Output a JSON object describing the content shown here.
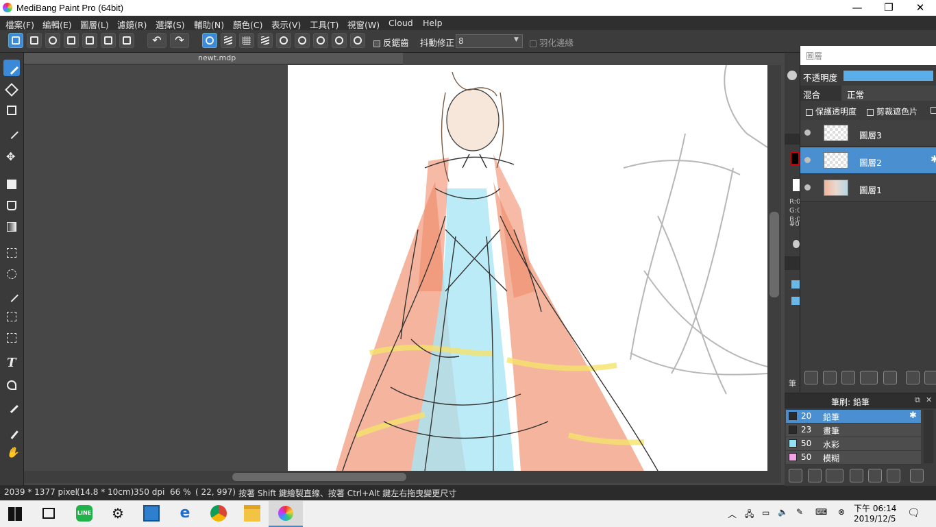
{
  "window": {
    "title": "MediBang Paint Pro (64bit)",
    "minimize": "—",
    "maximize": "❐",
    "close": "✕"
  },
  "menu": [
    "檔案(F)",
    "編輯(E)",
    "圖層(L)",
    "濾鏡(R)",
    "選擇(S)",
    "輔助(N)",
    "顏色(C)",
    "表示(V)",
    "工具(T)",
    "視窗(W)",
    "Cloud",
    "Help"
  ],
  "toolbar": {
    "antialias_label": "反鋸齒",
    "stabilizer_label": "抖動修正",
    "stabilizer_value": "8",
    "feather_label": "羽化邊緣",
    "undo_glyph": "↶",
    "redo_glyph": "↷"
  },
  "document": {
    "tab_title": "newt.mdp"
  },
  "status": {
    "size_px": "2039 * 1377 pixel",
    "size_cm": "(14.8 * 10cm)",
    "dpi": "350 dpi",
    "zoom": "66 %",
    "cursor": "( 22, 997)",
    "hint": "按著 Shift 鍵繪製直線、按著 Ctrl+Alt 鍵左右拖曳變更尺寸"
  },
  "layers_panel": {
    "title": "圖層",
    "opacity_label": "不透明度",
    "opacity_value": 1.0,
    "blend_label": "混合",
    "blend_value": "正常",
    "protect_alpha_label": "保護透明度",
    "clipping_label": "剪裁遮色片",
    "layers": [
      {
        "name": "圖層3",
        "selected": false
      },
      {
        "name": "圖層2",
        "selected": true
      },
      {
        "name": "圖層1",
        "selected": false
      }
    ]
  },
  "color_panel": {
    "r_label": "R:0",
    "g_label": "G:0",
    "b_label": "B:0",
    "hex_label": "#00",
    "primary_color": "#000000",
    "secondary_color": "#ffffff",
    "fg_accent": "#d00000"
  },
  "side_label": "筆",
  "brush_panel": {
    "title": "筆刷: 鉛筆",
    "brushes": [
      {
        "size": "20",
        "name": "鉛筆",
        "color": "#2a2a2a",
        "selected": true
      },
      {
        "size": "23",
        "name": "畫筆",
        "color": "#2a2a2a",
        "selected": false
      },
      {
        "size": "50",
        "name": "水彩",
        "color": "#8fe3f5",
        "selected": false
      },
      {
        "size": "50",
        "name": "模糊",
        "color": "#f5a3e8",
        "selected": false
      }
    ]
  },
  "taskbar": {
    "time": "下午 06:14",
    "date": "2019/12/5",
    "apps": [
      "windows-start",
      "task-view",
      "line",
      "settings",
      "control-panel",
      "edge",
      "chrome",
      "file-explorer",
      "medibang-paint"
    ]
  },
  "colors": {
    "accent": "#3b8ad9",
    "selection": "#4a8fd0",
    "panel": "#3c3c3c",
    "canvas": "#ffffff"
  }
}
